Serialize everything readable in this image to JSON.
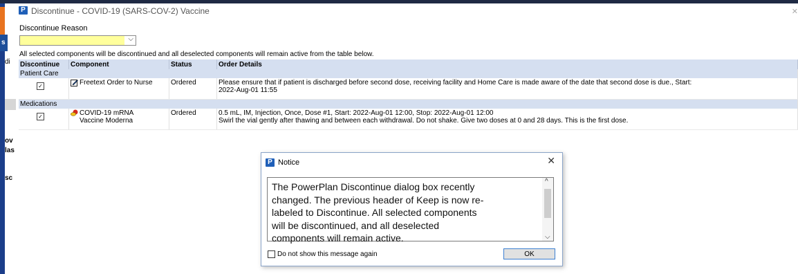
{
  "window": {
    "title": "Discontinue - COVID-19 (SARS-COV-2) Vaccine"
  },
  "background": {
    "fragments": [
      "s",
      "di",
      "ov",
      "las",
      "sc"
    ]
  },
  "form": {
    "reason_label": "Discontinue Reason",
    "reason_value": "",
    "info": "All selected components will be discontinued and all deselected components will remain active from the table below."
  },
  "table": {
    "headers": [
      "Discontinue",
      "Component",
      "Status",
      "Order Details"
    ],
    "sections": [
      {
        "name": "Patient Care",
        "rows": [
          {
            "checked": true,
            "component": "Freetext Order to Nurse",
            "component_line2": "",
            "status": "Ordered",
            "details": "Please ensure that if patient is discharged before second dose, receiving facility and Home Care is made aware of the date that second dose is due., Start:",
            "details_line2": "2022-Aug-01 11:55"
          }
        ]
      },
      {
        "name": "Medications",
        "rows": [
          {
            "checked": true,
            "component": "COVID-19 mRNA",
            "component_line2": "Vaccine Moderna",
            "status": "Ordered",
            "details": "0.5 mL, IM, Injection, Once, Dose #1, Start: 2022-Aug-01 12:00, Stop: 2022-Aug-01 12:00",
            "details_line2": "Swirl the vial gently after thawing and between each withdrawal. Do not shake. Give two doses at 0 and 28 days. This is the first dose."
          }
        ]
      }
    ]
  },
  "notice": {
    "title": "Notice",
    "message_lines": [
      "The PowerPlan Discontinue dialog box recently",
      "changed. The previous header of Keep is now re-",
      "labeled to Discontinue. All selected components",
      "will be discontinued, and all deselected",
      "components will remain active."
    ],
    "dont_show_label": "Do not show this message again",
    "ok_label": "OK"
  },
  "icons": {
    "app": "P",
    "checkmark": "✓",
    "close": "✕",
    "dropdown": "⌵",
    "scroll_up": "^",
    "scroll_down": "⌵"
  }
}
